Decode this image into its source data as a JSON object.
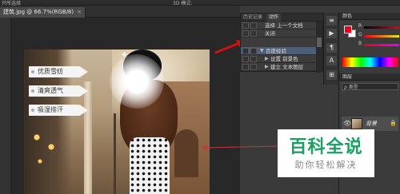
{
  "topbar": {
    "text": "只所选择",
    "right_text": "3D 模式: "
  },
  "document_tab": {
    "label": "建筑.jpg @ 66.7%(RGB/8)",
    "close": "×"
  },
  "image_tags": [
    {
      "label": "优质雪纺"
    },
    {
      "label": "清爽透气"
    },
    {
      "label": "吸湿排汗"
    }
  ],
  "actions_panel": {
    "tabs": [
      "历史记录",
      "动作"
    ],
    "rows": [
      {
        "label": "选择 上一个文档",
        "indent": 2,
        "triangle": ""
      },
      {
        "label": "关闭",
        "indent": 2,
        "triangle": ""
      },
      {
        "label": "百度经验",
        "indent": 1,
        "triangle": "▼",
        "selected": true
      },
      {
        "label": "设置 前景色",
        "indent": 2,
        "triangle": "▶"
      },
      {
        "label": "建立 文本图层",
        "indent": 2,
        "triangle": "▶"
      }
    ]
  },
  "right_panel": {
    "color_tab": "颜色",
    "sliders": [
      {
        "label": "R",
        "color": "#e8001c"
      },
      {
        "label": "G",
        "color": "#20c020"
      },
      {
        "label": "B",
        "color": "#2040ff"
      }
    ],
    "layers_tab": "图层",
    "filter_label": "ρ 类型",
    "layer": {
      "name": "背景",
      "eye": "👁",
      "lock": "🔒"
    }
  },
  "watermark": {
    "title": "百科全说",
    "subtitle": "助你轻松解决"
  },
  "colors": {
    "accent_green": "#1aa061",
    "arrow_red": "#d01010",
    "foreground": "#e8001c"
  }
}
